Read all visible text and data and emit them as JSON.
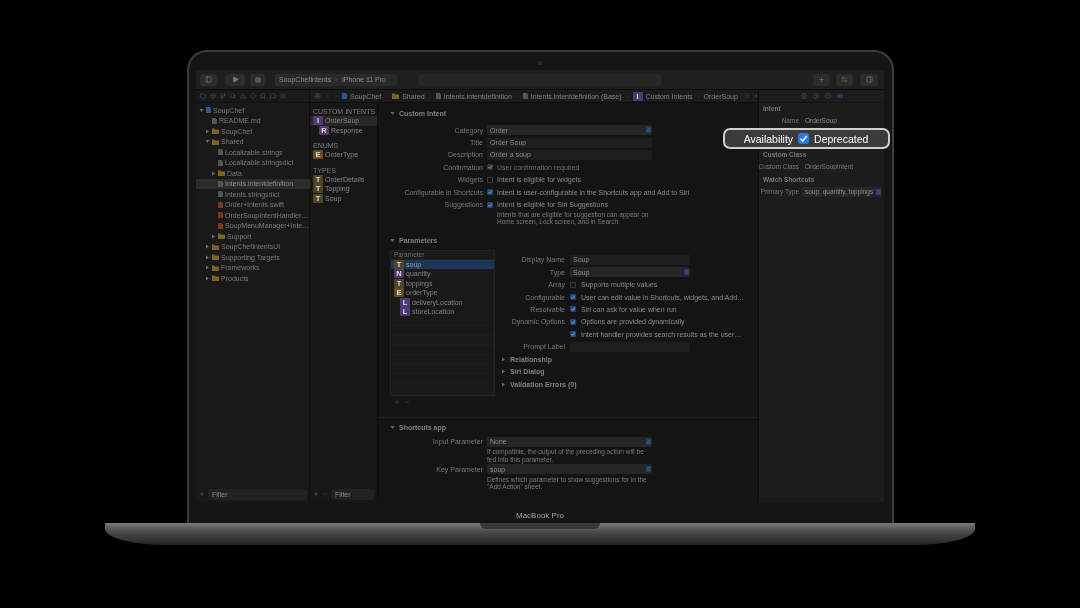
{
  "toolbar": {
    "scheme": "SoupChefIntents",
    "device": "iPhone 11 Pro"
  },
  "navigator": {
    "tabs": [
      {
        "selected": true
      },
      {
        "selected": false
      },
      {
        "selected": false
      },
      {
        "selected": false
      },
      {
        "selected": false
      },
      {
        "selected": false
      },
      {
        "selected": false
      },
      {
        "selected": false
      },
      {
        "selected": false
      }
    ],
    "items": [
      {
        "label": "SoupChef",
        "kind": "project",
        "expanded": true,
        "selected": false,
        "children": [
          {
            "label": "README.md",
            "kind": "file",
            "selected": false
          },
          {
            "label": "SoupChef",
            "kind": "folder",
            "expanded": false,
            "selected": false
          },
          {
            "label": "Shared",
            "kind": "folder",
            "expanded": true,
            "selected": false,
            "children": [
              {
                "label": "Localizable.strings",
                "kind": "file",
                "selected": false
              },
              {
                "label": "Localizable.stringsdict",
                "kind": "file",
                "selected": false
              },
              {
                "label": "Data",
                "kind": "folder",
                "expanded": false,
                "selected": false
              },
              {
                "label": "Intents.intentdefinition",
                "kind": "intents",
                "selected": true
              },
              {
                "label": "Intents.stringsdict",
                "kind": "file",
                "selected": false
              },
              {
                "label": "Order+Intents.swift",
                "kind": "swift",
                "selected": false
              },
              {
                "label": "OrderSoupIntentHandler…",
                "kind": "swift",
                "selected": false
              },
              {
                "label": "SoupMenuManager+Inte…",
                "kind": "swift",
                "selected": false
              },
              {
                "label": "Support",
                "kind": "folder",
                "expanded": false,
                "selected": false
              }
            ]
          },
          {
            "label": "SoupChefIntentsUI",
            "kind": "folder",
            "expanded": false,
            "selected": false
          },
          {
            "label": "Supporting Targets",
            "kind": "folder",
            "expanded": false,
            "selected": false
          },
          {
            "label": "Frameworks",
            "kind": "folder",
            "expanded": false,
            "selected": false
          },
          {
            "label": "Products",
            "kind": "folder",
            "expanded": false,
            "selected": false
          }
        ]
      }
    ],
    "filter": {
      "placeholder": "Filter"
    }
  },
  "breadcrumb": [
    {
      "label": "SoupChef",
      "kind": "project"
    },
    {
      "label": "Shared",
      "kind": "folder"
    },
    {
      "label": "Intents.intentdefinition",
      "kind": "intents"
    },
    {
      "label": "Intents.intentdefinition (Base)",
      "kind": "file"
    },
    {
      "label": "Custom Intents",
      "kind": "badge",
      "badge": "I",
      "color": "#4e3a6e"
    },
    {
      "label": "OrderSoup",
      "kind": "plain"
    }
  ],
  "outline": {
    "sections": [
      {
        "title": "CUSTOM INTENTS",
        "items": [
          {
            "badge": "I",
            "color": "#4e3a6e",
            "label": "OrderSoup",
            "selected": true,
            "children": [
              {
                "badge": "R",
                "color": "#55396e",
                "label": "Response",
                "selected": false
              }
            ]
          }
        ]
      },
      {
        "title": "ENUMS",
        "items": [
          {
            "badge": "E",
            "color": "#6a4a1e",
            "label": "OrderType",
            "selected": false
          }
        ]
      },
      {
        "title": "TYPES",
        "items": [
          {
            "badge": "T",
            "color": "#4f4424",
            "label": "OrderDetails",
            "selected": false
          },
          {
            "badge": "T",
            "color": "#4f4424",
            "label": "Topping",
            "selected": false
          },
          {
            "badge": "T",
            "color": "#4f4424",
            "label": "Soup",
            "selected": false
          }
        ]
      }
    ],
    "filter": {
      "placeholder": "Filter"
    }
  },
  "custom_intent": {
    "title": "Custom Intent",
    "expanded": true,
    "fields": [
      {
        "label": "Category",
        "kind": "popup",
        "value": "Order"
      },
      {
        "label": "Title",
        "kind": "text",
        "value": "Order Soup"
      },
      {
        "label": "Description",
        "kind": "text",
        "value": "Order a soup"
      },
      {
        "label": "Confirmation",
        "kind": "checkbox",
        "text": "User confirmation required",
        "checked": true,
        "disabled": true
      },
      {
        "label": "Widgets",
        "kind": "checkbox",
        "text": "Intent is eligible for widgets",
        "checked": false,
        "disabled": false
      },
      {
        "label": "Configurable in Shortcuts",
        "kind": "checkbox",
        "text": "Intent is user-configurable in the Shortcuts app and Add to Siri",
        "checked": true,
        "disabled": false
      },
      {
        "label": "Suggestions",
        "kind": "checkbox",
        "text": "Intent is eligible for Siri Suggestions",
        "checked": true,
        "disabled": false,
        "note": "Intents that are eligible for suggestion can appear on Home screen, Lock screen, and in Search."
      }
    ]
  },
  "parameters": {
    "title": "Parameters",
    "expanded": true,
    "column": "Parameter",
    "rows": [
      {
        "badge": "T",
        "color": "#4f4424",
        "name": "soup",
        "selected": true
      },
      {
        "badge": "N",
        "color": "#4a3a6a",
        "name": "quantity",
        "selected": false
      },
      {
        "badge": "T",
        "color": "#4f4424",
        "name": "toppings",
        "selected": false
      },
      {
        "badge": "E",
        "color": "#6a4a1e",
        "name": "orderType",
        "selected": false,
        "children": [
          {
            "badge": "L",
            "color": "#4e3a72",
            "name": "deliveryLocation",
            "selected": false
          },
          {
            "badge": "L",
            "color": "#4e3a72",
            "name": "storeLocation",
            "selected": false
          }
        ]
      }
    ],
    "details": [
      {
        "label": "Display Name",
        "kind": "text",
        "value": "Soup"
      },
      {
        "label": "Type",
        "kind": "popup",
        "value": "Soup"
      },
      {
        "label": "Array",
        "kind": "checkbox",
        "text": "Supports multiple values",
        "checked": false,
        "disabled": false
      },
      {
        "label": "Configurable",
        "kind": "checkbox",
        "text": "User can edit value in Shortcuts, widgets, and Add…",
        "checked": true,
        "disabled": false
      },
      {
        "label": "Resolvable",
        "kind": "checkbox",
        "text": "Siri can ask for value when run",
        "checked": true,
        "disabled": false
      },
      {
        "label": "Dynamic Options",
        "kind": "checkbox",
        "text": "Options are provided dynamically",
        "checked": true,
        "disabled": false
      },
      {
        "kind": "checkbox",
        "text": "Intent handler provides search results as the user…",
        "checked": true,
        "disabled": false
      },
      {
        "label": "Prompt Label",
        "kind": "text"
      }
    ],
    "disclosures": [
      {
        "title": "Relationship",
        "expanded": false
      },
      {
        "title": "Siri Dialog",
        "expanded": false
      },
      {
        "title": "Validation Errors (0)",
        "expanded": false
      }
    ]
  },
  "shortcuts_app": {
    "title": "Shortcuts app",
    "expanded": true,
    "fields": [
      {
        "label": "Input Parameter",
        "kind": "popup",
        "value": "None",
        "note": "If compatible, the output of the preceding action will be fed into this parameter."
      },
      {
        "label": "Key Parameter",
        "kind": "popup",
        "value": "soup",
        "note": "Defines which parameter to show suggestions for in the \"Add Action\" sheet."
      }
    ]
  },
  "inspector": {
    "tabs": [
      {
        "selected": false
      },
      {
        "selected": false
      },
      {
        "selected": false
      },
      {
        "selected": true
      }
    ],
    "sections": [
      {
        "title": "Intent",
        "fields": [
          {
            "label": "Name",
            "kind": "text",
            "value": "OrderSoup"
          }
        ]
      },
      {
        "title": "Custom Class",
        "fields": [
          {
            "label": "Custom Class",
            "kind": "text",
            "placeholder": "OrderSoupIntent"
          }
        ]
      },
      {
        "title": "Watch Shortcuts",
        "fields": [
          {
            "label": "Primary Type",
            "kind": "popup",
            "value": "soup, quantity, toppings"
          }
        ]
      }
    ]
  },
  "callout": {
    "label": "Availability",
    "checked": true,
    "text": "Deprecated"
  },
  "laptop": {
    "model": "MacBook Pro"
  }
}
